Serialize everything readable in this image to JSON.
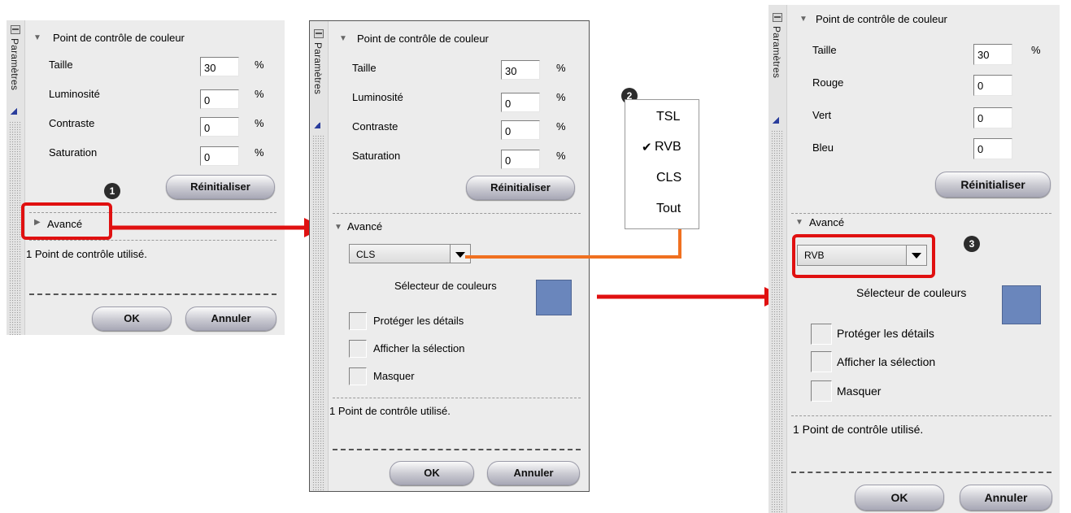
{
  "panels": [
    {
      "side_label": "Paramètres",
      "section_title": "Point de contrôle de couleur",
      "fields": [
        {
          "label": "Taille",
          "value": "30",
          "unit": "%"
        },
        {
          "label": "Luminosité",
          "value": "0",
          "unit": "%"
        },
        {
          "label": "Contraste",
          "value": "0",
          "unit": "%"
        },
        {
          "label": "Saturation",
          "value": "0",
          "unit": "%"
        }
      ],
      "reset_label": "Réinitialiser",
      "advanced_label": "Avancé",
      "status": "1 Point de contrôle utilisé.",
      "ok_label": "OK",
      "cancel_label": "Annuler"
    },
    {
      "side_label": "Paramètres",
      "section_title": "Point de contrôle de couleur",
      "fields": [
        {
          "label": "Taille",
          "value": "30",
          "unit": "%"
        },
        {
          "label": "Luminosité",
          "value": "0",
          "unit": "%"
        },
        {
          "label": "Contraste",
          "value": "0",
          "unit": "%"
        },
        {
          "label": "Saturation",
          "value": "0",
          "unit": "%"
        }
      ],
      "reset_label": "Réinitialiser",
      "advanced_label": "Avancé",
      "mode_value": "CLS",
      "color_picker_label": "Sélecteur de couleurs",
      "checkboxes": [
        "Protéger les détails",
        "Afficher la sélection",
        "Masquer"
      ],
      "status": "1 Point de contrôle utilisé.",
      "ok_label": "OK",
      "cancel_label": "Annuler"
    },
    {
      "side_label": "Paramètres",
      "section_title": "Point de contrôle de couleur",
      "fields": [
        {
          "label": "Taille",
          "value": "30",
          "unit": "%"
        },
        {
          "label": "Rouge",
          "value": "0",
          "unit": ""
        },
        {
          "label": "Vert",
          "value": "0",
          "unit": ""
        },
        {
          "label": "Bleu",
          "value": "0",
          "unit": ""
        }
      ],
      "reset_label": "Réinitialiser",
      "advanced_label": "Avancé",
      "mode_value": "RVB",
      "color_picker_label": "Sélecteur de couleurs",
      "checkboxes": [
        "Protéger les détails",
        "Afficher la sélection",
        "Masquer"
      ],
      "status": "1 Point de contrôle utilisé.",
      "ok_label": "OK",
      "cancel_label": "Annuler"
    }
  ],
  "popup_menu": {
    "items": [
      "TSL",
      "RVB",
      "CLS",
      "Tout"
    ],
    "check_mark": "✔",
    "checked_item": "RVB"
  },
  "step_markers": [
    "1",
    "2",
    "3"
  ],
  "colors": {
    "highlight": "#e01010",
    "connector": "#f07020",
    "swatch": "#6a86bc",
    "panel_bg": "#ececec"
  }
}
